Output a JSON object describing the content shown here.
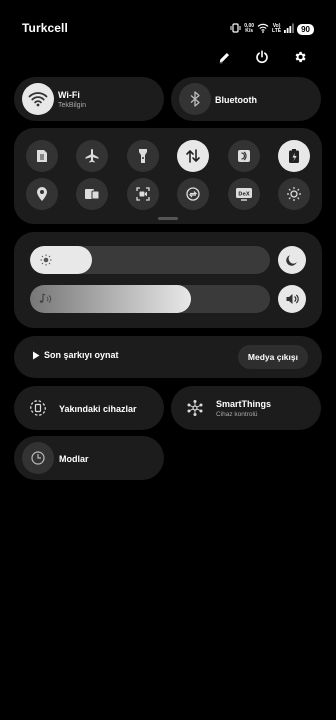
{
  "status_bar": {
    "carrier": "Turkcell",
    "speed_value": "0,00",
    "speed_unit": "K/s",
    "volte_top": "Vo)",
    "volte_bottom": "LTE",
    "battery": "90"
  },
  "top_actions": {
    "icons": [
      "edit-icon",
      "power-icon",
      "settings-icon"
    ]
  },
  "wifi": {
    "title": "Wi-Fi",
    "subtitle": "TekBilgin",
    "state": "on"
  },
  "bluetooth": {
    "title": "Bluetooth",
    "state": "off"
  },
  "quick_tiles": {
    "row1": [
      "sim-icon",
      "airplane-icon",
      "flashlight-icon",
      "mobile-data-icon",
      "nfc-icon",
      "battery-saver-icon"
    ],
    "row2": [
      "location-icon",
      "multi-device-icon",
      "screen-recorder-icon",
      "sync-icon",
      "dex-icon",
      "eye-comfort-icon"
    ],
    "dex_text": "DeX"
  },
  "brightness": {
    "level": 0.26
  },
  "volume": {
    "level": 0.67
  },
  "media": {
    "play_label": "Son şarkıyı oynat",
    "output_label": "Medya çıkışı"
  },
  "nearby": {
    "title": "Yakındaki cihazlar"
  },
  "smartthings": {
    "title": "SmartThings",
    "subtitle": "Cihaz kontrolü"
  },
  "modes": {
    "title": "Modlar"
  }
}
